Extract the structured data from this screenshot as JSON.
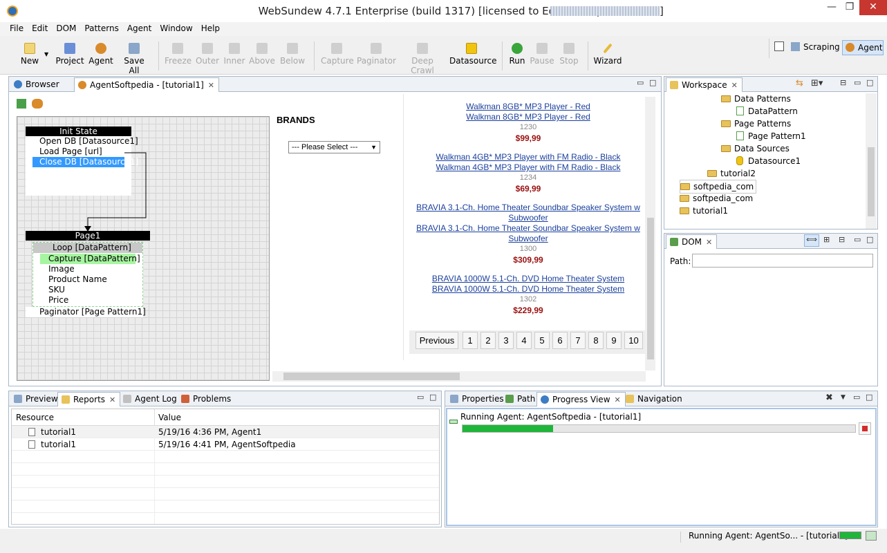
{
  "window": {
    "title": "WebSundew 4.7.1 Enterprise (build 1317) [licensed to Editor Softpedia,",
    "minimize": "—",
    "maximize": "❐",
    "close": "✕"
  },
  "menu": [
    "File",
    "Edit",
    "DOM",
    "Patterns",
    "Agent",
    "Window",
    "Help"
  ],
  "toolbar": {
    "new": "New",
    "project": "Project",
    "agent": "Agent",
    "save_all": "Save All",
    "freeze": "Freeze",
    "outer": "Outer",
    "inner": "Inner",
    "above": "Above",
    "below": "Below",
    "capture": "Capture",
    "paginator": "Paginator",
    "deep_crawl": "Deep Crawl",
    "datasource": "Datasource",
    "run": "Run",
    "pause": "Pause",
    "stop": "Stop",
    "wizard": "Wizard",
    "perspective_scraping": "Scraping",
    "perspective_agent": "Agent"
  },
  "editor": {
    "tabs": [
      {
        "label": "Browser"
      },
      {
        "label": "AgentSoftpedia - [tutorial1]"
      }
    ]
  },
  "diagram": {
    "init_state": {
      "title": "Init State",
      "items": [
        "Open DB [Datasource1]",
        "Load Page [url]",
        "Close DB [Datasource1]"
      ]
    },
    "page1": {
      "title": "Page1",
      "loop": "Loop [DataPattern]",
      "capture": "Capture [DataPattern]",
      "fields": [
        "Image",
        "Product Name",
        "SKU",
        "Price"
      ],
      "paginator": "Paginator [Page Pattern1]"
    }
  },
  "browser": {
    "brands_label": "BRANDS",
    "select_value": "--- Please Select ---",
    "products": [
      {
        "title": "Walkman 8GB* MP3 Player - Red",
        "title2": "Walkman 8GB* MP3 Player - Red",
        "sku": "1230",
        "price": "$99,99"
      },
      {
        "title": "Walkman 4GB* MP3 Player with FM Radio - Black",
        "title2": "Walkman 4GB* MP3 Player with FM Radio - Black",
        "sku": "1234",
        "price": "$69,99"
      },
      {
        "title": "BRAVIA 3.1-Ch. Home Theater Soundbar Speaker System w",
        "title_b": "Subwoofer",
        "title2": "BRAVIA 3.1-Ch. Home Theater Soundbar Speaker System w",
        "title2_b": "Subwoofer",
        "sku": "1300",
        "price": "$309,99"
      },
      {
        "title": "BRAVIA 1000W 5.1-Ch. DVD Home Theater System",
        "title2": "BRAVIA 1000W 5.1-Ch. DVD Home Theater System",
        "sku": "1302",
        "price": "$229,99"
      }
    ],
    "pagination": [
      "Previous",
      "1",
      "2",
      "3",
      "4",
      "5",
      "6",
      "7",
      "8",
      "9",
      "10"
    ]
  },
  "workspace": {
    "tab": "Workspace",
    "items": [
      "Data Patterns",
      "DataPattern",
      "Page Patterns",
      "Page Pattern1",
      "Data Sources",
      "Datasource1",
      "tutorial2",
      "softpedia_com",
      "softpedia_com",
      "tutorial1"
    ]
  },
  "dom": {
    "tab": "DOM",
    "path_label": "Path:",
    "path_value": ""
  },
  "reports": {
    "tabs": [
      "Preview",
      "Reports",
      "Agent Log",
      "Problems"
    ],
    "columns": [
      "Resource",
      "Value"
    ],
    "rows": [
      {
        "resource": "tutorial1",
        "value": "5/19/16 4:36 PM, Agent1"
      },
      {
        "resource": "tutorial1",
        "value": "5/19/16 4:41 PM, AgentSoftpedia"
      }
    ]
  },
  "progress": {
    "tabs": [
      "Properties",
      "Path",
      "Progress View",
      "Navigation"
    ],
    "task": "Running Agent: AgentSoftpedia - [tutorial1]",
    "fraction": 0.23
  },
  "statusbar": {
    "text": "Running Agent: AgentSo... - [tutorial1]"
  },
  "colors": {
    "accent": "#2a7fd4",
    "progress": "#1fb53a",
    "selection": "#3399ff",
    "capture": "#a6f5a0"
  }
}
